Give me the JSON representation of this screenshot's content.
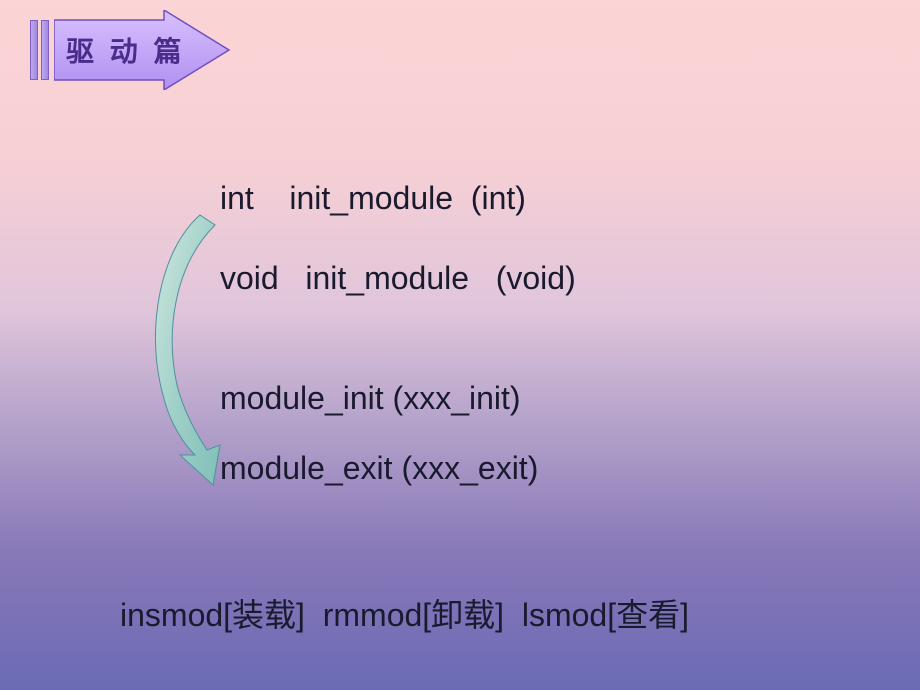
{
  "header": {
    "title": "驱 动 篇"
  },
  "code": {
    "line1": "int    init_module  (int)",
    "line2": "void   init_module   (void)",
    "line3": "module_init (xxx_init)",
    "line4": "module_exit (xxx_exit)"
  },
  "commands": {
    "text": "insmod[装载]  rmmod[卸载]  lsmod[查看]"
  }
}
